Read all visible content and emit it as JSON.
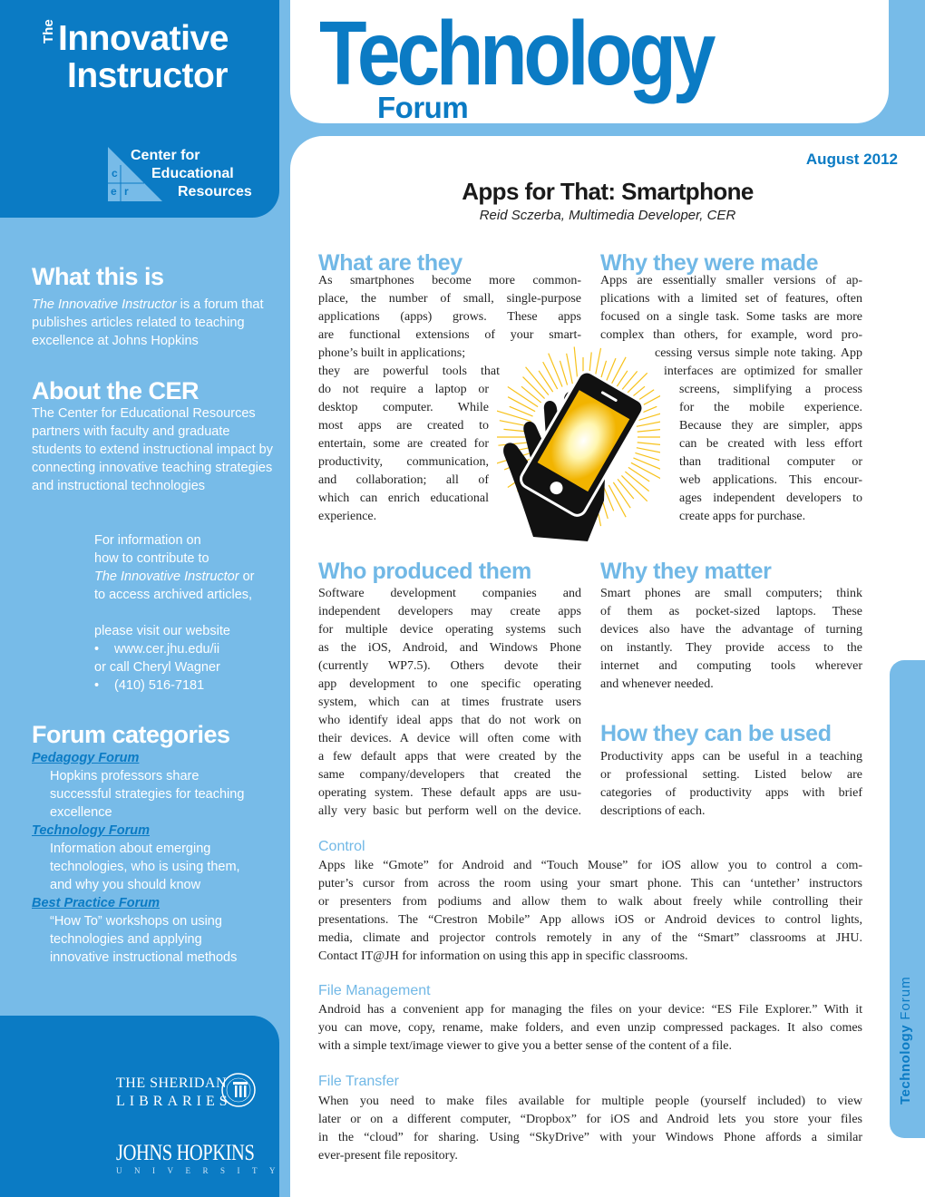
{
  "masthead": {
    "the": "The",
    "title_line1": "Innovative",
    "title_line2": "Instructor",
    "series_word": "Technology",
    "series_sub": "Forum",
    "cer_line1": "Center for",
    "cer_line2": "Educational",
    "cer_line3": "Resources",
    "cer_letters": [
      "c",
      "e",
      "r"
    ],
    "issue_date": "August 2012"
  },
  "article": {
    "title": "Apps for That: Smartphone",
    "author": "Reid Sczerba, Multimedia Developer, CER"
  },
  "sidebar": {
    "what_heading": "What this is",
    "what_italic": "The Innovative Instructor",
    "what_text": " is a forum that publishes articles related to teaching excellence at Johns Hopkins",
    "about_heading": "About the CER",
    "about_text": "The Center for Educational Resources partners with faculty and graduate students to extend instructional impact by connecting innovative teaching strategies and instructional technologies",
    "contact": {
      "line1": "For information on",
      "line2": "how to contribute to",
      "line3_italic": "The Innovative Instructor",
      "line3_rest": " or",
      "line4": "to access archived articles,",
      "line5": "please visit our website",
      "website": "www.cer.jhu.edu/ii",
      "line6": "or call Cheryl Wagner",
      "phone": "(410) 516-7181",
      "bullet": "•"
    },
    "categories_heading": "Forum categories",
    "categories": [
      {
        "name": "Pedagogy Forum",
        "desc": [
          "Hopkins professors share",
          "successful strategies for teaching",
          "excellence"
        ]
      },
      {
        "name": "Technology Forum",
        "desc": [
          "Information about emerging",
          "technologies, who is using them,",
          "and why you should know"
        ]
      },
      {
        "name": "Best Practice Forum",
        "desc": [
          "“How To” workshops on using",
          "technologies and applying",
          "innovative instructional methods"
        ]
      }
    ],
    "sheridan_line1": "THE SHERIDAN",
    "sheridan_line2": "LIBRARIES",
    "jhu_name": "JOHNS HOPKINS",
    "jhu_sub": "UNIVERSITY"
  },
  "sections": {
    "what_are_they": {
      "heading": "What are they",
      "lines": [
        "As smartphones become more common-",
        "place, the number of small, single-purpose",
        "applications (apps) grows. These apps",
        "are functional extensions of your smart-",
        "phone’s built in applications;",
        "they are powerful tools that",
        "do not require a laptop or",
        "desktop computer. While",
        "most apps are created to",
        "entertain, some are created for",
        "productivity, communication,",
        "and collaboration; all of",
        "which can enrich educational",
        "experience."
      ]
    },
    "why_made": {
      "heading": "Why they were made",
      "lines": [
        "Apps are essentially smaller versions of ap-",
        "plications with a limited set of features, often",
        "focused on a single task. Some tasks are more",
        "complex than others, for example, word pro-",
        "cessing versus simple note taking. App",
        "interfaces are optimized for smaller",
        "screens, simplifying a process",
        "for the mobile experience.",
        "Because they are simpler, apps",
        "can be created with less effort",
        "than traditional computer or",
        "web applications. This encour-",
        "ages independent developers to",
        "create apps for purchase."
      ]
    },
    "who_produced": {
      "heading": "Who produced them",
      "lines": [
        "Software development companies and",
        "independent developers may create apps",
        "for multiple device operating systems such",
        "as the iOS, Android, and Windows Phone",
        "(currently WP7.5). Others devote their",
        "app development to one specific operating",
        "system, which can at times frustrate users",
        "who identify ideal apps that do not work on",
        "their devices. A device will often come with",
        "a few default apps that were created by the",
        "same company/developers that created the",
        "operating system. These default apps are usu-",
        "ally very basic but perform well on the device."
      ]
    },
    "why_matter": {
      "heading": "Why they matter",
      "lines": [
        "Smart phones are small computers; think",
        "of them as pocket-sized laptops. These",
        "devices also have the advantage of turning",
        "on instantly. They provide access to the",
        "internet and computing tools wherever",
        "and whenever needed."
      ]
    },
    "how_used": {
      "heading": "How they can be used",
      "lines": [
        "Productivity apps can be useful in a teaching",
        "or professional setting. Listed below are",
        "categories of productivity apps with brief",
        "descriptions of each."
      ]
    },
    "control": {
      "heading": "Control",
      "lines": [
        "Apps like “Gmote” for Android and “Touch Mouse” for iOS allow you to control a com-",
        "puter’s cursor from across the room using your smart phone. This can ‘untether’ instructors",
        "or presenters from podiums and allow them to walk about freely while controlling their",
        "presentations. The “Crestron Mobile” App allows iOS or Android devices to control lights,",
        "media, climate and projector controls remotely in any of the “Smart” classrooms at JHU.",
        "Contact IT@JH for information on using this app in specific classrooms."
      ]
    },
    "file_management": {
      "heading": "File Management",
      "lines": [
        "Android has a convenient app for managing the files on your device: “ES File Explorer.” With it",
        "you can move, copy, rename, make folders, and even unzip compressed packages. It also comes",
        "with a simple text/image viewer to give you a better sense of the content of a file."
      ]
    },
    "file_transfer": {
      "heading": "File Transfer",
      "lines": [
        "When you need to make files available for multiple people (yourself included) to view",
        "later or on a different computer, “Dropbox” for iOS and Android lets you store your files",
        "in the “cloud” for sharing. Using “SkyDrive” with your Windows Phone affords a similar",
        "ever-present file repository."
      ]
    }
  },
  "side_tab": {
    "bold": "Technology",
    "rest": " Forum"
  },
  "colors": {
    "brand_blue": "#0b7bc4",
    "light_blue": "#77bbe8",
    "heading_blue": "#71b8e6",
    "accent_yellow": "#f7c21b"
  }
}
